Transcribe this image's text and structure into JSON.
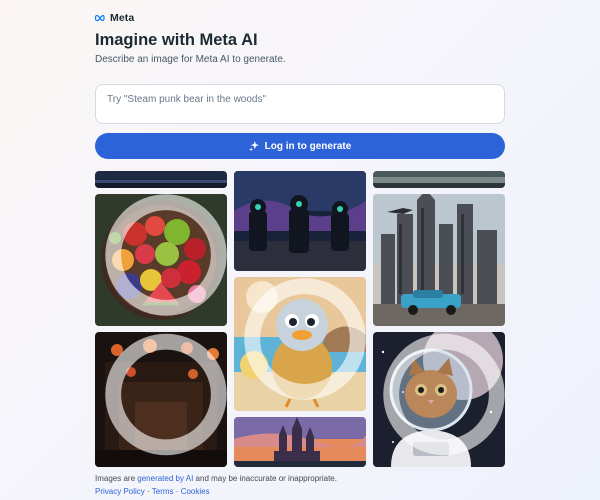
{
  "brand": {
    "name": "Meta",
    "logo_icon": "meta-infinity-icon"
  },
  "header": {
    "title": "Imagine with Meta AI",
    "subtitle": "Describe an image for Meta AI to generate."
  },
  "prompt": {
    "placeholder": "Try \"Steam punk bear in the woods\"",
    "value": ""
  },
  "generate_button": {
    "label": "Log in to generate",
    "icon": "sparkle-icon"
  },
  "gallery": {
    "images": [
      "image-dark-sky-strip",
      "image-fruit-bowl",
      "image-lantern-hall",
      "image-space-soldiers",
      "image-fluffy-duck-character",
      "image-castle-sunset",
      "image-foggy-strip",
      "image-futuristic-city-car",
      "image-astronaut-kitten"
    ]
  },
  "footer": {
    "disclaimer_prefix": "Images are",
    "disclaimer_link": "generated by AI",
    "disclaimer_suffix": "and may be inaccurate or inappropriate.",
    "privacy": "Privacy Policy",
    "sep1": "·",
    "terms": "Terms",
    "sep2": "·",
    "cookies": "Cookies"
  },
  "colors": {
    "accent": "#2d63d9",
    "text": "#1c2b33"
  }
}
